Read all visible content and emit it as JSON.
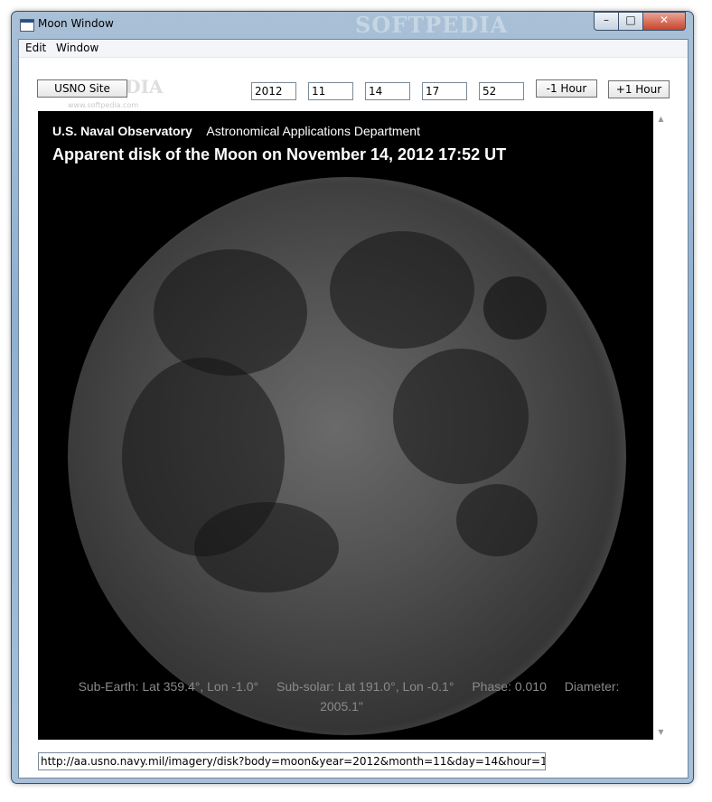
{
  "window": {
    "title": "Moon Window",
    "watermark": "SOFTPEDIA",
    "controls": {
      "minimize": "–",
      "maximize": "□",
      "close": "✕"
    }
  },
  "menu": [
    {
      "label": "Edit"
    },
    {
      "label": "Window"
    }
  ],
  "toolbar": {
    "site_button": "USNO Site",
    "year": "2012",
    "month": "11",
    "day": "14",
    "hour": "17",
    "minute": "52",
    "minus_hour": "-1 Hour",
    "plus_hour": "+1 Hour",
    "watermark": "SOFTPEDIA",
    "watermark_url": "www.softpedia.com"
  },
  "viewer": {
    "org": "U.S. Naval Observatory",
    "dept": "Astronomical Applications Department",
    "title": "Apparent disk of the Moon on November 14, 2012 17:52 UT",
    "sub_earth": "Sub-Earth: Lat 359.4°, Lon -1.0°",
    "sub_solar": "Sub-solar: Lat 191.0°, Lon -0.1°",
    "phase": "Phase: 0.010",
    "diameter": "Diameter: 2005.1\""
  },
  "url": "http://aa.usno.navy.mil/imagery/disk?body=moon&year=2012&month=11&day=14&hour=17&minute="
}
